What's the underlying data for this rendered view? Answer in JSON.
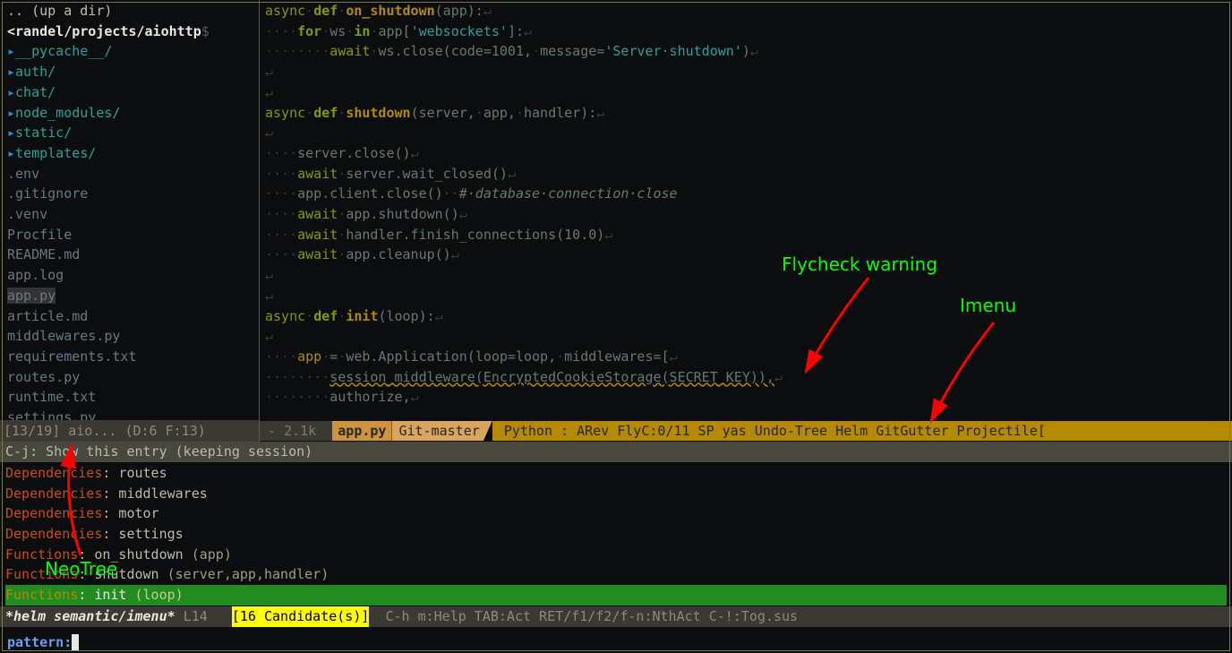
{
  "neotree": {
    "up": ".. (up a dir)",
    "path": "<randel/projects/aiohttp",
    "prompt": "$",
    "dirs": [
      "__pycache__/",
      "auth/",
      "chat/",
      "node_modules/",
      "static/",
      "templates/"
    ],
    "files": [
      ".env",
      ".gitignore",
      ".venv",
      "Procfile",
      "README.md",
      "app.log",
      "app.py",
      "article.md",
      "middlewares.py",
      "requirements.txt",
      "routes.py",
      "runtime.txt",
      "settings.py"
    ],
    "selected": "app.py",
    "modeline": "[13/19] aio... (D:6 F:13)"
  },
  "code": {
    "lines": [
      {
        "t": [
          {
            "c": "kw2",
            "s": "async"
          },
          {
            "c": "ws",
            "s": "·"
          },
          {
            "c": "kw",
            "s": "def"
          },
          {
            "c": "ws",
            "s": "·"
          },
          {
            "c": "fn-b",
            "s": "on_shutdown"
          },
          {
            "c": "dim",
            "s": "(app):"
          },
          {
            "c": "eol",
            "s": "↵"
          }
        ]
      },
      {
        "t": [
          {
            "c": "ws",
            "s": "····"
          },
          {
            "c": "kw",
            "s": "for"
          },
          {
            "c": "ws",
            "s": "·"
          },
          {
            "c": "dim",
            "s": "ws"
          },
          {
            "c": "ws",
            "s": "·"
          },
          {
            "c": "kw",
            "s": "in"
          },
          {
            "c": "ws",
            "s": "·"
          },
          {
            "c": "dim",
            "s": "app["
          },
          {
            "c": "str",
            "s": "'websockets'"
          },
          {
            "c": "dim",
            "s": "]:"
          },
          {
            "c": "eol",
            "s": "↵"
          }
        ]
      },
      {
        "t": [
          {
            "c": "ws",
            "s": "········"
          },
          {
            "c": "kw2",
            "s": "await"
          },
          {
            "c": "ws",
            "s": "·"
          },
          {
            "c": "dim",
            "s": "ws.close(code=1001,"
          },
          {
            "c": "ws",
            "s": "·"
          },
          {
            "c": "dim",
            "s": "message="
          },
          {
            "c": "str",
            "s": "'Server·shutdown'"
          },
          {
            "c": "dim",
            "s": ")"
          },
          {
            "c": "eol",
            "s": "↵"
          }
        ]
      },
      {
        "t": [
          {
            "c": "eol",
            "s": "↵"
          }
        ]
      },
      {
        "t": [
          {
            "c": "eol",
            "s": "↵"
          }
        ]
      },
      {
        "t": [
          {
            "c": "kw2",
            "s": "async"
          },
          {
            "c": "ws",
            "s": "·"
          },
          {
            "c": "kw",
            "s": "def"
          },
          {
            "c": "ws",
            "s": "·"
          },
          {
            "c": "fn-b",
            "s": "shutdown"
          },
          {
            "c": "dim",
            "s": "(server,"
          },
          {
            "c": "ws",
            "s": "·"
          },
          {
            "c": "dim",
            "s": "app,"
          },
          {
            "c": "ws",
            "s": "·"
          },
          {
            "c": "dim",
            "s": "handler):"
          },
          {
            "c": "eol",
            "s": "↵"
          }
        ]
      },
      {
        "t": [
          {
            "c": "eol",
            "s": "↵"
          }
        ]
      },
      {
        "t": [
          {
            "c": "ws",
            "s": "····"
          },
          {
            "c": "dim",
            "s": "server.close()"
          },
          {
            "c": "eol",
            "s": "↵"
          }
        ]
      },
      {
        "t": [
          {
            "c": "ws",
            "s": "····"
          },
          {
            "c": "kw2",
            "s": "await"
          },
          {
            "c": "ws",
            "s": "·"
          },
          {
            "c": "dim",
            "s": "server.wait_closed()"
          },
          {
            "c": "eol",
            "s": "↵"
          }
        ]
      },
      {
        "t": [
          {
            "c": "ws",
            "s": "····"
          },
          {
            "c": "dim",
            "s": "app.client.close()"
          },
          {
            "c": "ws",
            "s": "··"
          },
          {
            "c": "cmt",
            "s": "#·database·connection·close"
          }
        ]
      },
      {
        "t": [
          {
            "c": "ws",
            "s": "····"
          },
          {
            "c": "kw2",
            "s": "await"
          },
          {
            "c": "ws",
            "s": "·"
          },
          {
            "c": "dim",
            "s": "app.shutdown()"
          },
          {
            "c": "eol",
            "s": "↵"
          }
        ]
      },
      {
        "t": [
          {
            "c": "ws",
            "s": "····"
          },
          {
            "c": "kw2",
            "s": "await"
          },
          {
            "c": "ws",
            "s": "·"
          },
          {
            "c": "dim",
            "s": "handler.finish_connections(10.0)"
          },
          {
            "c": "eol",
            "s": "↵"
          }
        ]
      },
      {
        "t": [
          {
            "c": "ws",
            "s": "····"
          },
          {
            "c": "kw2",
            "s": "await"
          },
          {
            "c": "ws",
            "s": "·"
          },
          {
            "c": "dim",
            "s": "app.cleanup()"
          },
          {
            "c": "eol",
            "s": "↵"
          }
        ]
      },
      {
        "t": [
          {
            "c": "eol",
            "s": "↵"
          }
        ]
      },
      {
        "t": [
          {
            "c": "eol",
            "s": "↵"
          }
        ]
      },
      {
        "t": [
          {
            "c": "kw2",
            "s": "async"
          },
          {
            "c": "ws",
            "s": "·"
          },
          {
            "c": "kw",
            "s": "def"
          },
          {
            "c": "ws",
            "s": "·"
          },
          {
            "c": "fn-b",
            "s": "init"
          },
          {
            "c": "dim",
            "s": "(loop):"
          },
          {
            "c": "eol",
            "s": "↵"
          }
        ]
      },
      {
        "t": [
          {
            "c": "eol",
            "s": "↵"
          }
        ]
      },
      {
        "t": [
          {
            "c": "ws",
            "s": "····"
          },
          {
            "c": "fn",
            "s": "app"
          },
          {
            "c": "ws",
            "s": "·"
          },
          {
            "c": "dim",
            "s": "="
          },
          {
            "c": "ws",
            "s": "·"
          },
          {
            "c": "dim",
            "s": "web.Application(loop=loop,"
          },
          {
            "c": "ws",
            "s": "·"
          },
          {
            "c": "dim",
            "s": "middlewares=["
          },
          {
            "c": "eol",
            "s": "↵"
          }
        ]
      },
      {
        "t": [
          {
            "c": "ws",
            "s": "········"
          },
          {
            "c": "warnl",
            "s": "session_middleware(EncryptedCookieStorage(SECRET_KEY)),"
          },
          {
            "c": "eol",
            "s": "↵"
          }
        ]
      },
      {
        "t": [
          {
            "c": "ws",
            "s": "········"
          },
          {
            "c": "dim",
            "s": "authorize,"
          },
          {
            "c": "eol",
            "s": "↵"
          }
        ]
      }
    ],
    "modeline": {
      "pre": " - 2.1k  ",
      "file": "app.py",
      "git": "Git-master",
      "rest": " Python : ARev FlyC:0/11 SP yas Undo-Tree Helm GitGutter Projectile["
    }
  },
  "helm": {
    "header": "C-j: Show this entry (keeping session)",
    "rows": [
      {
        "grp": "Dependencies",
        "sym": "routes"
      },
      {
        "grp": "Dependencies",
        "sym": "middlewares"
      },
      {
        "grp": "Dependencies",
        "sym": "motor"
      },
      {
        "grp": "Dependencies",
        "sym": "settings"
      },
      {
        "grp": "Functions",
        "sym": "on_shutdown",
        "sig": "(app)"
      },
      {
        "grp": "Functions",
        "sym": "shutdown",
        "sig": "(server,app,handler)"
      }
    ],
    "sel": {
      "grp": "Functions",
      "sym": "init",
      "sig": "(loop)"
    },
    "modeline": {
      "buf": "*helm semantic/imenu*",
      "pos": "L14",
      "cand": "[16 Candidate(s)]",
      "rest": "C-h m:Help TAB:Act RET/f1/f2/f-n:NthAct C-!:Tog.sus"
    }
  },
  "minibuf": {
    "label": "pattern: "
  },
  "annotations": {
    "flycheck": "Flycheck warning",
    "imenu": "Imenu",
    "neotree": "NeoTree"
  }
}
